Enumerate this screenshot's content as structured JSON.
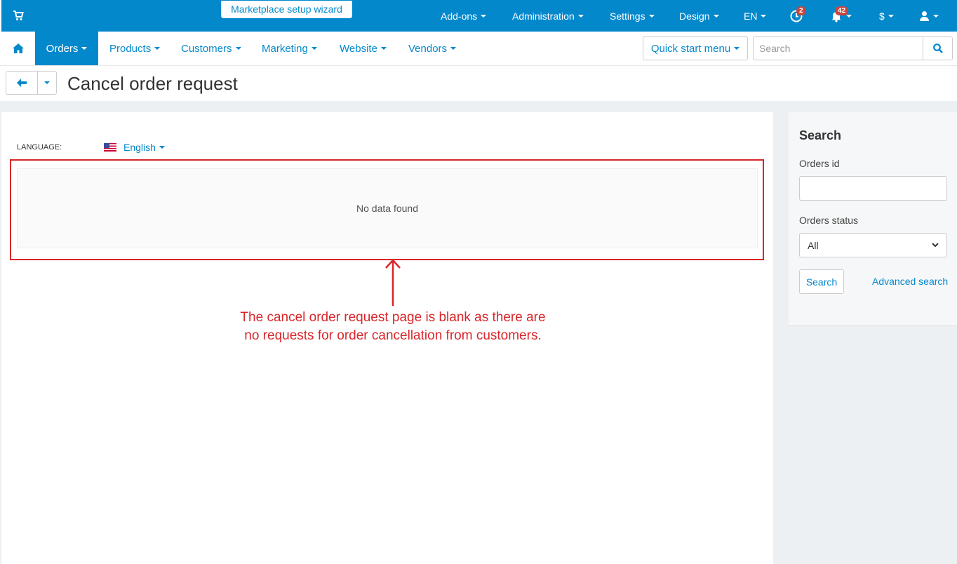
{
  "topbar": {
    "wizard_label": "Marketplace setup wizard",
    "items": [
      "Add-ons",
      "Administration",
      "Settings",
      "Design",
      "EN"
    ],
    "badge_clock": "2",
    "badge_bell": "42",
    "currency": "$"
  },
  "nav": {
    "orders": "Orders",
    "products": "Products",
    "customers": "Customers",
    "marketing": "Marketing",
    "website": "Website",
    "vendors": "Vendors",
    "quick_start": "Quick start menu",
    "search_placeholder": "Search"
  },
  "page": {
    "title": "Cancel order request",
    "language_label": "LANGUAGE:",
    "language_value": "English",
    "no_data": "No data found",
    "annotation": "The cancel order request page is blank as there are no requests for order cancellation from customers."
  },
  "sidebar": {
    "title": "Search",
    "orders_id_label": "Orders id",
    "orders_status_label": "Orders status",
    "orders_status_value": "All",
    "search_button": "Search",
    "advanced_search": "Advanced search"
  },
  "colors": {
    "brand": "#0388cc",
    "annotation_red": "#d9262a",
    "badge": "#c8463d"
  }
}
